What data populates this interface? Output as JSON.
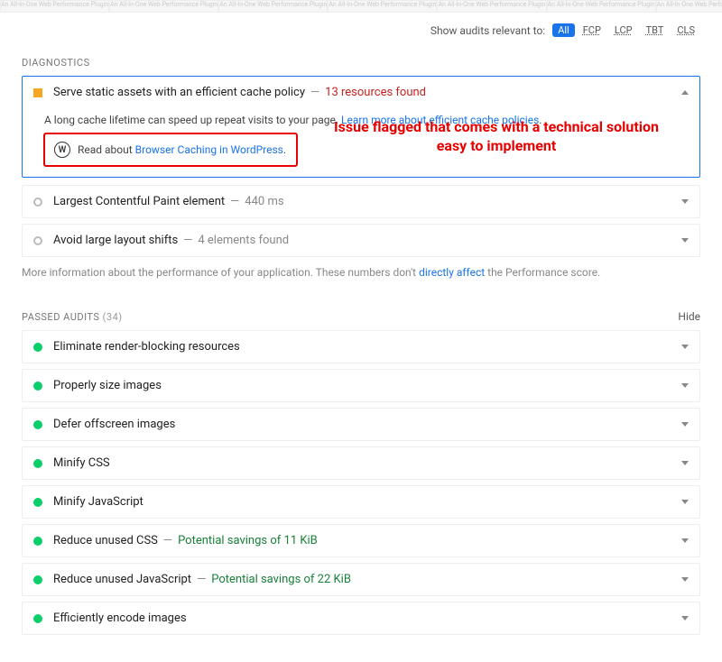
{
  "faded_band_label": "An All-In-One Web Performance Plugin",
  "filter": {
    "label": "Show audits relevant to:",
    "options": [
      "All",
      "FCP",
      "LCP",
      "TBT",
      "CLS"
    ],
    "active": "All"
  },
  "diagnostics": {
    "heading": "DIAGNOSTICS",
    "expanded": {
      "title": "Serve static assets with an efficient cache policy",
      "meta": "13 resources found",
      "description_prefix": "A long cache lifetime can speed up repeat visits to your page. ",
      "description_link": "Learn more about efficient cache policies",
      "description_suffix": ".",
      "infobox_prefix": "Read about ",
      "infobox_link": "Browser Caching in WordPress",
      "infobox_suffix": "."
    },
    "rows": [
      {
        "title": "Largest Contentful Paint element",
        "meta": "440 ms",
        "meta_class": "meta-gray",
        "bullet": "circle-gray"
      },
      {
        "title": "Avoid large layout shifts",
        "meta": "4 elements found",
        "meta_class": "meta-gray",
        "bullet": "circle-gray"
      }
    ],
    "footer_prefix": "More information about the performance of your application. These numbers don't ",
    "footer_link": "directly affect",
    "footer_suffix": " the Performance score."
  },
  "annotation": "Issue flagged that comes with a technical solution easy to implement",
  "passed": {
    "heading": "PASSED AUDITS",
    "count": "(34)",
    "hide_label": "Hide",
    "rows": [
      {
        "title": "Eliminate render-blocking resources",
        "meta": "",
        "meta_class": ""
      },
      {
        "title": "Properly size images",
        "meta": "",
        "meta_class": ""
      },
      {
        "title": "Defer offscreen images",
        "meta": "",
        "meta_class": ""
      },
      {
        "title": "Minify CSS",
        "meta": "",
        "meta_class": ""
      },
      {
        "title": "Minify JavaScript",
        "meta": "",
        "meta_class": ""
      },
      {
        "title": "Reduce unused CSS",
        "meta": "Potential savings of 11 KiB",
        "meta_class": "meta-green"
      },
      {
        "title": "Reduce unused JavaScript",
        "meta": "Potential savings of 22 KiB",
        "meta_class": "meta-green"
      },
      {
        "title": "Efficiently encode images",
        "meta": "",
        "meta_class": ""
      }
    ]
  },
  "wp_glyph": "W",
  "dash": "—"
}
